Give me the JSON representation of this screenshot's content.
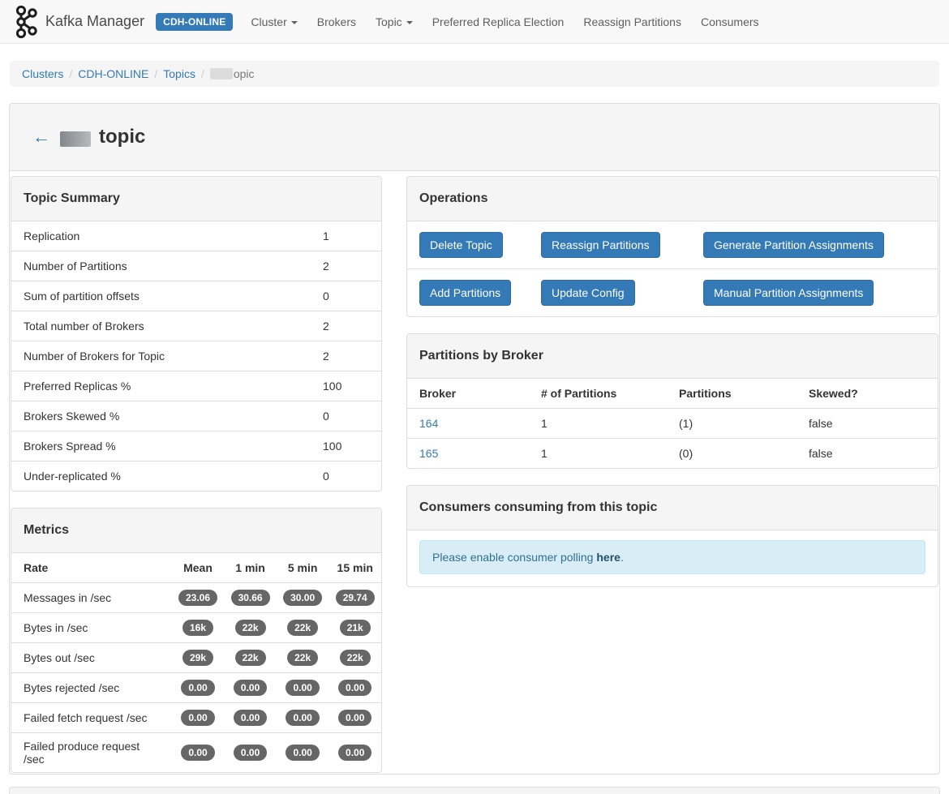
{
  "icons": {
    "back_arrow": "←"
  },
  "navbar": {
    "brand": "Kafka Manager",
    "cluster_badge": "CDH-ONLINE",
    "items": [
      {
        "label": "Cluster"
      },
      {
        "label": "Brokers"
      },
      {
        "label": "Topic"
      },
      {
        "label": "Preferred Replica Election"
      },
      {
        "label": "Reassign Partitions"
      },
      {
        "label": "Consumers"
      }
    ]
  },
  "breadcrumb": {
    "separator": "/",
    "items": [
      "Clusters",
      "CDH-ONLINE",
      "Topics"
    ],
    "current_suffix": "opic"
  },
  "page": {
    "title_suffix": "topic"
  },
  "topic_summary": {
    "title": "Topic Summary",
    "rows": [
      {
        "label": "Replication",
        "value": "1"
      },
      {
        "label": "Number of Partitions",
        "value": "2"
      },
      {
        "label": "Sum of partition offsets",
        "value": "0"
      },
      {
        "label": "Total number of Brokers",
        "value": "2"
      },
      {
        "label": "Number of Brokers for Topic",
        "value": "2"
      },
      {
        "label": "Preferred Replicas %",
        "value": "100"
      },
      {
        "label": "Brokers Skewed %",
        "value": "0"
      },
      {
        "label": "Brokers Spread %",
        "value": "100"
      },
      {
        "label": "Under-replicated %",
        "value": "0"
      }
    ]
  },
  "metrics": {
    "title": "Metrics",
    "headers": [
      "Rate",
      "Mean",
      "1 min",
      "5 min",
      "15 min"
    ],
    "rows": [
      {
        "label": "Messages in /sec",
        "values": [
          "23.06",
          "30.66",
          "30.00",
          "29.74"
        ]
      },
      {
        "label": "Bytes in /sec",
        "values": [
          "16k",
          "22k",
          "22k",
          "21k"
        ]
      },
      {
        "label": "Bytes out /sec",
        "values": [
          "29k",
          "22k",
          "22k",
          "22k"
        ]
      },
      {
        "label": "Bytes rejected /sec",
        "values": [
          "0.00",
          "0.00",
          "0.00",
          "0.00"
        ]
      },
      {
        "label": "Failed fetch request /sec",
        "values": [
          "0.00",
          "0.00",
          "0.00",
          "0.00"
        ]
      },
      {
        "label": "Failed produce request /sec",
        "values": [
          "0.00",
          "0.00",
          "0.00",
          "0.00"
        ]
      }
    ]
  },
  "operations": {
    "title": "Operations",
    "row1": [
      "Delete Topic",
      "Reassign Partitions",
      "Generate Partition Assignments"
    ],
    "row2": [
      "Add Partitions",
      "Update Config",
      "Manual Partition Assignments"
    ]
  },
  "partitions_by_broker": {
    "title": "Partitions by Broker",
    "headers": [
      "Broker",
      "# of Partitions",
      "Partitions",
      "Skewed?"
    ],
    "rows": [
      {
        "broker": "164",
        "num": "1",
        "partitions": "(1)",
        "skewed": "false"
      },
      {
        "broker": "165",
        "num": "1",
        "partitions": "(0)",
        "skewed": "false"
      }
    ]
  },
  "consumers": {
    "title": "Consumers consuming from this topic",
    "alert_prefix": "Please enable consumer polling ",
    "alert_link": "here",
    "alert_suffix": "."
  }
}
